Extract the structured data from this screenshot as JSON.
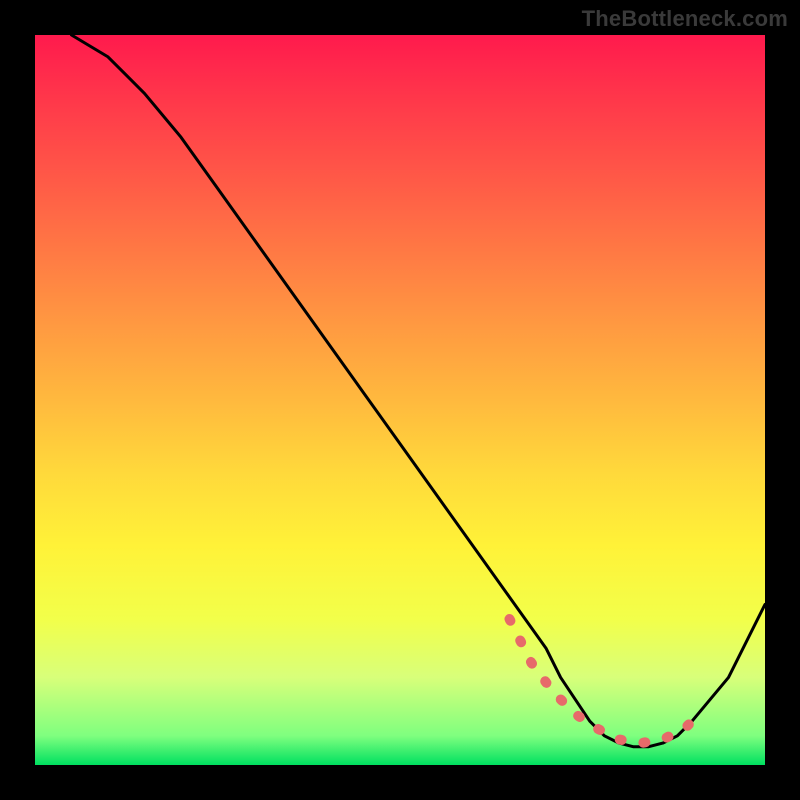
{
  "watermark": "TheBottleneck.com",
  "chart_data": {
    "type": "line",
    "title": "",
    "xlabel": "",
    "ylabel": "",
    "xlim": [
      0,
      100
    ],
    "ylim": [
      0,
      100
    ],
    "grid": false,
    "series": [
      {
        "name": "bottleneck-curve",
        "x": [
          5,
          10,
          15,
          20,
          25,
          30,
          35,
          40,
          45,
          50,
          55,
          60,
          65,
          70,
          72,
          74,
          76,
          78,
          80,
          82,
          84,
          86,
          88,
          90,
          95,
          100
        ],
        "y": [
          100,
          97,
          92,
          86,
          79,
          72,
          65,
          58,
          51,
          44,
          37,
          30,
          23,
          16,
          12,
          9,
          6,
          4,
          3,
          2.5,
          2.5,
          3,
          4,
          6,
          12,
          22
        ]
      }
    ],
    "highlight": {
      "name": "optimal-range",
      "x": [
        65,
        68,
        71,
        74,
        77,
        80,
        83,
        86,
        89,
        91
      ],
      "y": [
        20,
        14,
        10,
        7,
        5,
        3.5,
        3,
        3.5,
        5,
        7
      ]
    },
    "gradient_stops": [
      {
        "pos": 0.0,
        "color": "#ff1a4d"
      },
      {
        "pos": 0.5,
        "color": "#ffb93e"
      },
      {
        "pos": 0.8,
        "color": "#f2ff4a"
      },
      {
        "pos": 0.96,
        "color": "#7fff7f"
      },
      {
        "pos": 1.0,
        "color": "#00e060"
      }
    ]
  }
}
